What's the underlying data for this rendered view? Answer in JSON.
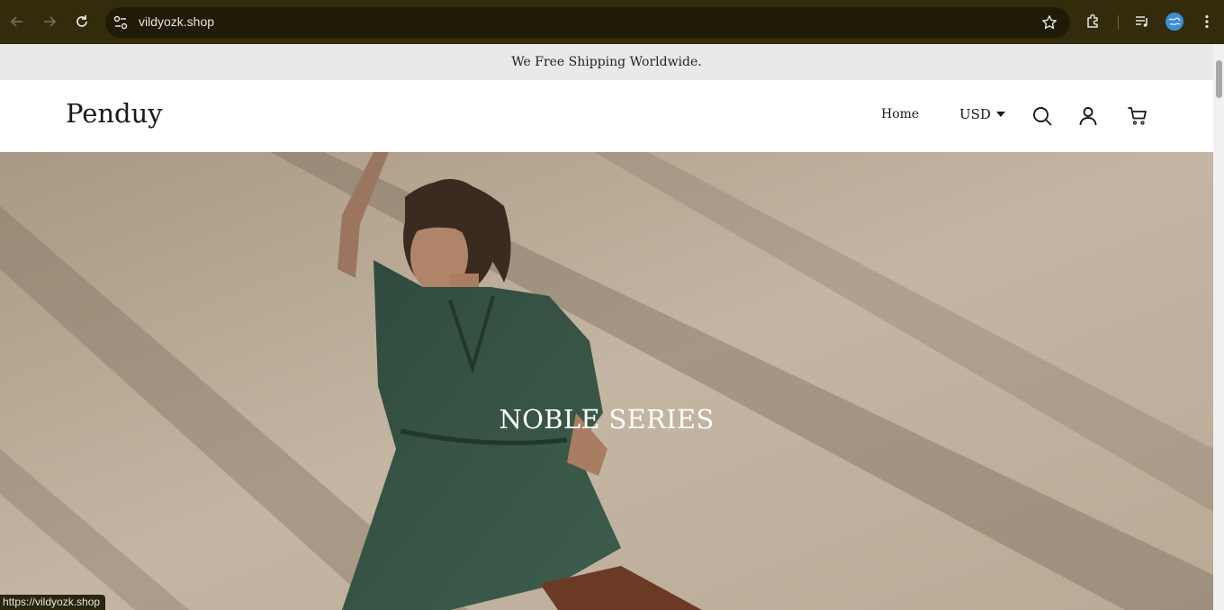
{
  "browser": {
    "url": "vildyozk.shop",
    "status_url": "https://vildyozk.shop"
  },
  "announcement": {
    "text": "We Free Shipping Worldwide."
  },
  "header": {
    "logo": "Penduy",
    "nav": [
      {
        "label": "Home"
      }
    ],
    "currency": "USD",
    "icons": [
      "search-icon",
      "account-icon",
      "cart-icon"
    ]
  },
  "hero": {
    "title": "NOBLE SERIES"
  }
}
